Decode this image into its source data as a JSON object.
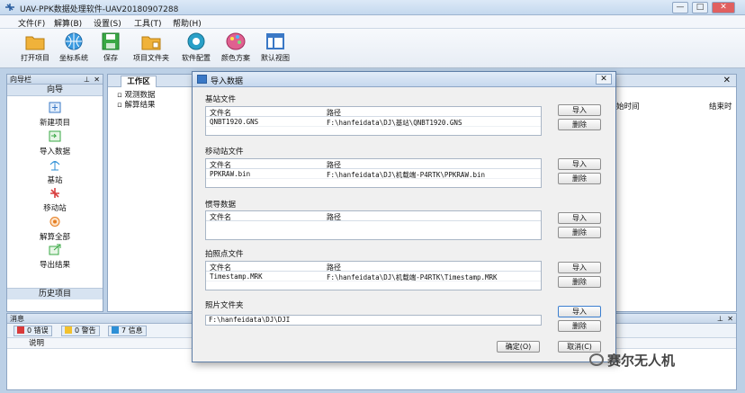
{
  "window": {
    "title": "UAV-PPK数据处理软件-UAV20180907288",
    "controls": {
      "minimize": "—",
      "maximize": "□",
      "close": "✕"
    }
  },
  "menu": [
    "文件(F)",
    "解算(B)",
    "设置(S)",
    "工具(T)",
    "帮助(H)"
  ],
  "toolbar": [
    {
      "label": "打开项目",
      "icon": "folder-open-icon",
      "color": "#e8a32a"
    },
    {
      "label": "坐标系统",
      "icon": "globe-icon",
      "color": "#2d8fd6"
    },
    {
      "label": "保存",
      "icon": "save-icon",
      "color": "#3aa845"
    },
    {
      "label": "项目文件夹",
      "icon": "project-folder-icon",
      "color": "#e8a32a"
    },
    {
      "label": "软件配置",
      "icon": "config-icon",
      "color": "#2aa0c8"
    },
    {
      "label": "颜色方案",
      "icon": "palette-icon",
      "color": "#d9457a"
    },
    {
      "label": "默认视图",
      "icon": "default-view-icon",
      "color": "#3a78c6"
    }
  ],
  "left_panel": {
    "title": "向导栏",
    "pin": "⊥",
    "close": "✕",
    "header": "向导",
    "items": [
      {
        "label": "新建项目",
        "icon": "new-project-icon"
      },
      {
        "label": "导入数据",
        "icon": "import-data-icon"
      },
      {
        "label": "基站",
        "icon": "base-station-icon"
      },
      {
        "label": "移动站",
        "icon": "rover-icon"
      },
      {
        "label": "解算全部",
        "icon": "solve-all-icon"
      },
      {
        "label": "导出结果",
        "icon": "export-icon"
      }
    ],
    "footer": "历史项目"
  },
  "work_area": {
    "tab": "工作区",
    "tab_close": "✕",
    "tree": [
      "观测数据",
      "解算结果"
    ],
    "columns": [
      "始时间",
      "结束时"
    ]
  },
  "messages": {
    "title": "消息",
    "pin": "⊥",
    "close": "✕",
    "errors": "0 错误",
    "warnings": "0 警告",
    "info": "7 信息",
    "column": "说明"
  },
  "dialog": {
    "title": "导入数据",
    "close": "✕",
    "col_name": "文件名",
    "col_path": "路径",
    "import_label": "导入",
    "delete_label": "删除",
    "sections": [
      {
        "title": "基站文件",
        "rows": [
          {
            "name": "QNBT1920.GNS",
            "path": "F:\\hanfeidata\\DJ\\基站\\QNBT1920.GNS"
          }
        ]
      },
      {
        "title": "移动站文件",
        "rows": [
          {
            "name": "PPKRAW.bin",
            "path": "F:\\hanfeidata\\DJ\\机载端-P4RTK\\PPKRAW.bin"
          }
        ]
      },
      {
        "title": "惯导数据",
        "rows": []
      },
      {
        "title": "拍照点文件",
        "rows": [
          {
            "name": "Timestamp.MRK",
            "path": "F:\\hanfeidata\\DJ\\机载端-P4RTK\\Timestamp.MRK"
          }
        ]
      }
    ],
    "photo_folder": {
      "title": "照片文件夹",
      "path": "F:\\hanfeidata\\DJ\\DJI"
    },
    "ok_label": "确定(O)",
    "cancel_label": "取消(C)"
  },
  "watermark": "赛尔无人机"
}
